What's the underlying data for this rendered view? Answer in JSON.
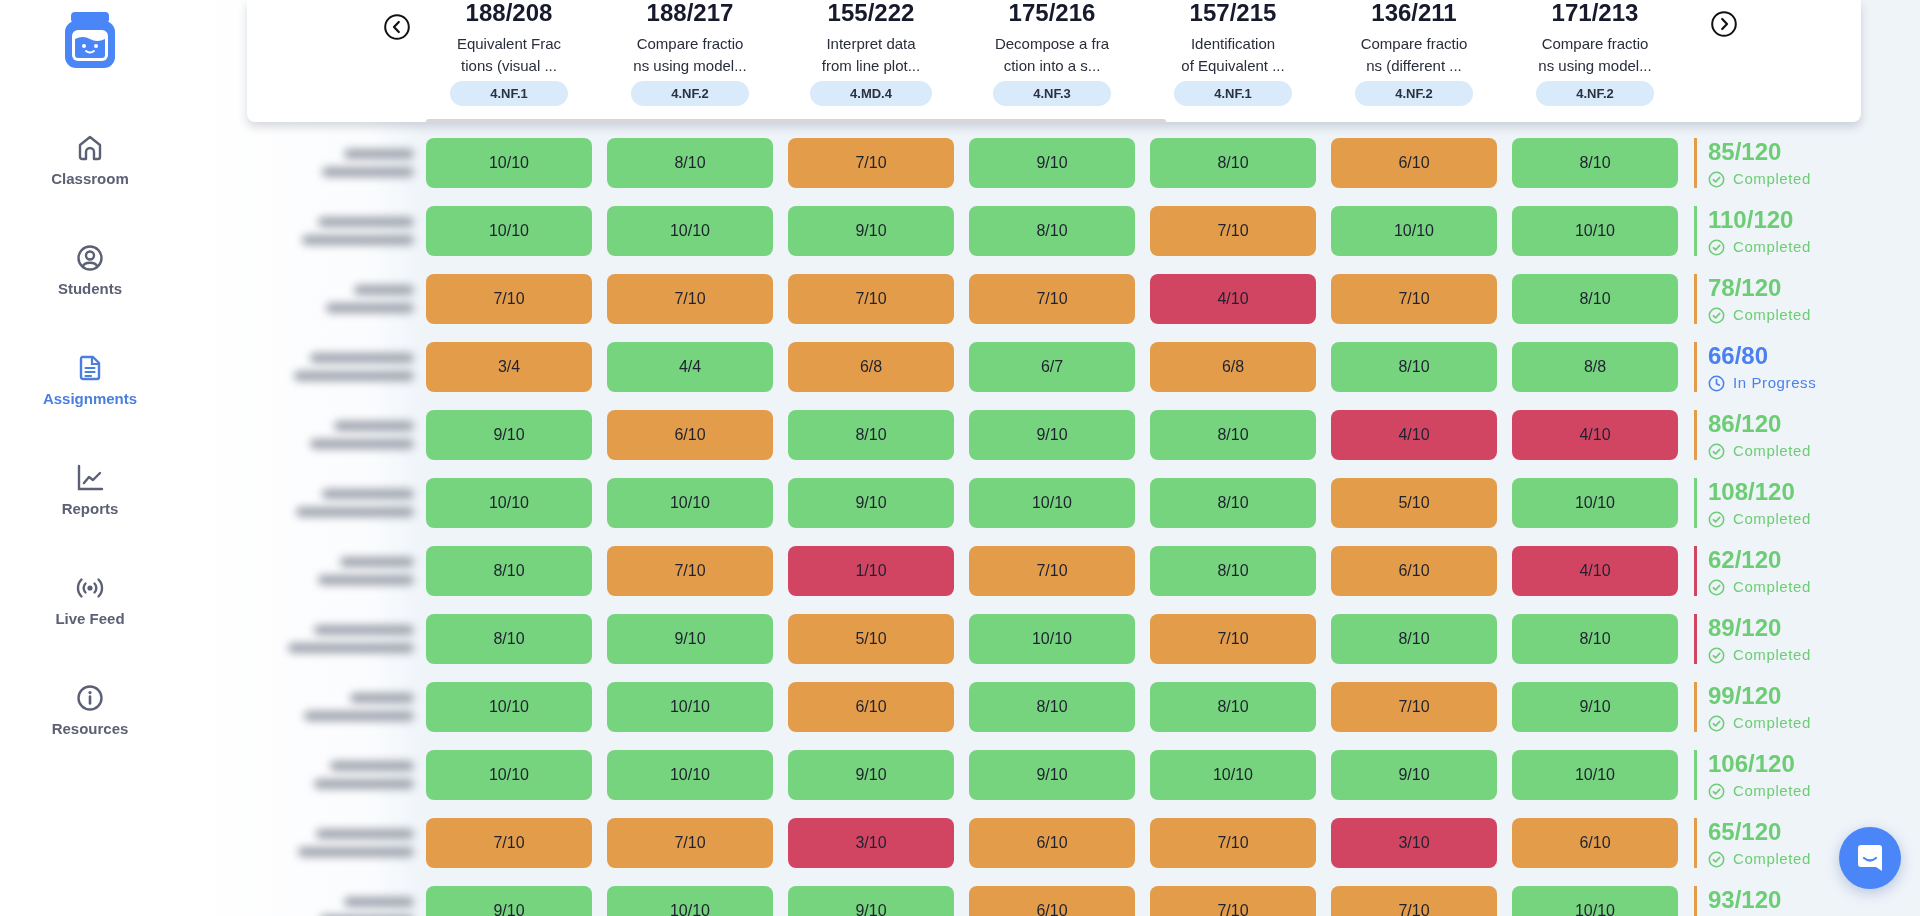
{
  "sidebar": {
    "nav": [
      {
        "label": "Classroom",
        "selected": false
      },
      {
        "label": "Students",
        "selected": false
      },
      {
        "label": "Assignments",
        "selected": true
      },
      {
        "label": "Reports",
        "selected": false
      },
      {
        "label": "Live Feed",
        "selected": false
      },
      {
        "label": "Resources",
        "selected": false
      }
    ]
  },
  "assignment_columns": [
    {
      "count": "188/208",
      "title": [
        "Equivalent Frac",
        "tions (visual ..."
      ],
      "tag": "4.NF.1"
    },
    {
      "count": "188/217",
      "title": [
        "Compare fractio",
        "ns using model..."
      ],
      "tag": "4.NF.2"
    },
    {
      "count": "155/222",
      "title": [
        "Interpret data",
        "from line plot..."
      ],
      "tag": "4.MD.4"
    },
    {
      "count": "175/216",
      "title": [
        "Decompose a fra",
        "ction into a s..."
      ],
      "tag": "4.NF.3"
    },
    {
      "count": "157/215",
      "title": [
        "Identification",
        "of Equivalent ..."
      ],
      "tag": "4.NF.1"
    },
    {
      "count": "136/211",
      "title": [
        "Compare fractio",
        "ns (different ..."
      ],
      "tag": "4.NF.2"
    },
    {
      "count": "171/213",
      "title": [
        "Compare fractio",
        "ns using model..."
      ],
      "tag": "4.NF.2"
    }
  ],
  "rows": [
    {
      "cells": [
        {
          "score": "10/10",
          "color": "#76d37e"
        },
        {
          "score": "8/10",
          "color": "#76d37e"
        },
        {
          "score": "7/10",
          "color": "#e39c4a"
        },
        {
          "score": "9/10",
          "color": "#76d37e"
        },
        {
          "score": "8/10",
          "color": "#76d37e"
        },
        {
          "score": "6/10",
          "color": "#e39c4a"
        },
        {
          "score": "8/10",
          "color": "#76d37e"
        }
      ],
      "next_cell": {
        "color": "#e39c4a"
      },
      "total": {
        "score": "85/120",
        "status": "Completed",
        "kind": "completed"
      }
    },
    {
      "cells": [
        {
          "score": "10/10",
          "color": "#76d37e"
        },
        {
          "score": "10/10",
          "color": "#76d37e"
        },
        {
          "score": "9/10",
          "color": "#76d37e"
        },
        {
          "score": "8/10",
          "color": "#76d37e"
        },
        {
          "score": "7/10",
          "color": "#e39c4a"
        },
        {
          "score": "10/10",
          "color": "#76d37e"
        },
        {
          "score": "10/10",
          "color": "#76d37e"
        }
      ],
      "next_cell": {
        "color": "#76d37e"
      },
      "total": {
        "score": "110/120",
        "status": "Completed",
        "kind": "completed"
      }
    },
    {
      "cells": [
        {
          "score": "7/10",
          "color": "#e39c4a"
        },
        {
          "score": "7/10",
          "color": "#e39c4a"
        },
        {
          "score": "7/10",
          "color": "#e39c4a"
        },
        {
          "score": "7/10",
          "color": "#e39c4a"
        },
        {
          "score": "4/10",
          "color": "#d24562"
        },
        {
          "score": "7/10",
          "color": "#e39c4a"
        },
        {
          "score": "8/10",
          "color": "#76d37e"
        }
      ],
      "next_cell": {
        "color": "#e39c4a"
      },
      "total": {
        "score": "78/120",
        "status": "Completed",
        "kind": "completed"
      }
    },
    {
      "cells": [
        {
          "score": "3/4",
          "color": "#e39c4a"
        },
        {
          "score": "4/4",
          "color": "#76d37e"
        },
        {
          "score": "6/8",
          "color": "#e39c4a"
        },
        {
          "score": "6/7",
          "color": "#76d37e"
        },
        {
          "score": "6/8",
          "color": "#e39c4a"
        },
        {
          "score": "8/10",
          "color": "#76d37e"
        },
        {
          "score": "8/8",
          "color": "#76d37e"
        }
      ],
      "next_cell": {
        "color": "#e39c4a"
      },
      "total": {
        "score": "66/80",
        "status": "In Progress",
        "kind": "in_progress"
      }
    },
    {
      "cells": [
        {
          "score": "9/10",
          "color": "#76d37e"
        },
        {
          "score": "6/10",
          "color": "#e39c4a"
        },
        {
          "score": "8/10",
          "color": "#76d37e"
        },
        {
          "score": "9/10",
          "color": "#76d37e"
        },
        {
          "score": "8/10",
          "color": "#76d37e"
        },
        {
          "score": "4/10",
          "color": "#d24562"
        },
        {
          "score": "4/10",
          "color": "#d24562"
        }
      ],
      "next_cell": {
        "color": "#e39c4a"
      },
      "total": {
        "score": "86/120",
        "status": "Completed",
        "kind": "completed"
      }
    },
    {
      "cells": [
        {
          "score": "10/10",
          "color": "#76d37e"
        },
        {
          "score": "10/10",
          "color": "#76d37e"
        },
        {
          "score": "9/10",
          "color": "#76d37e"
        },
        {
          "score": "10/10",
          "color": "#76d37e"
        },
        {
          "score": "8/10",
          "color": "#76d37e"
        },
        {
          "score": "5/10",
          "color": "#e39c4a"
        },
        {
          "score": "10/10",
          "color": "#76d37e"
        }
      ],
      "next_cell": {
        "color": "#76d37e"
      },
      "total": {
        "score": "108/120",
        "status": "Completed",
        "kind": "completed"
      }
    },
    {
      "cells": [
        {
          "score": "8/10",
          "color": "#76d37e"
        },
        {
          "score": "7/10",
          "color": "#e39c4a"
        },
        {
          "score": "1/10",
          "color": "#d24562"
        },
        {
          "score": "7/10",
          "color": "#e39c4a"
        },
        {
          "score": "8/10",
          "color": "#76d37e"
        },
        {
          "score": "6/10",
          "color": "#e39c4a"
        },
        {
          "score": "4/10",
          "color": "#d24562"
        }
      ],
      "next_cell": {
        "color": "#d24562"
      },
      "total": {
        "score": "62/120",
        "status": "Completed",
        "kind": "completed"
      }
    },
    {
      "cells": [
        {
          "score": "8/10",
          "color": "#76d37e"
        },
        {
          "score": "9/10",
          "color": "#76d37e"
        },
        {
          "score": "5/10",
          "color": "#e39c4a"
        },
        {
          "score": "10/10",
          "color": "#76d37e"
        },
        {
          "score": "7/10",
          "color": "#e39c4a"
        },
        {
          "score": "8/10",
          "color": "#76d37e"
        },
        {
          "score": "8/10",
          "color": "#76d37e"
        }
      ],
      "next_cell": {
        "color": "#d24562"
      },
      "total": {
        "score": "89/120",
        "status": "Completed",
        "kind": "completed"
      }
    },
    {
      "cells": [
        {
          "score": "10/10",
          "color": "#76d37e"
        },
        {
          "score": "10/10",
          "color": "#76d37e"
        },
        {
          "score": "6/10",
          "color": "#e39c4a"
        },
        {
          "score": "8/10",
          "color": "#76d37e"
        },
        {
          "score": "8/10",
          "color": "#76d37e"
        },
        {
          "score": "7/10",
          "color": "#e39c4a"
        },
        {
          "score": "9/10",
          "color": "#76d37e"
        }
      ],
      "next_cell": {
        "color": "#e39c4a"
      },
      "total": {
        "score": "99/120",
        "status": "Completed",
        "kind": "completed"
      }
    },
    {
      "cells": [
        {
          "score": "10/10",
          "color": "#76d37e"
        },
        {
          "score": "10/10",
          "color": "#76d37e"
        },
        {
          "score": "9/10",
          "color": "#76d37e"
        },
        {
          "score": "9/10",
          "color": "#76d37e"
        },
        {
          "score": "10/10",
          "color": "#76d37e"
        },
        {
          "score": "9/10",
          "color": "#76d37e"
        },
        {
          "score": "10/10",
          "color": "#76d37e"
        }
      ],
      "next_cell": {
        "color": "#76d37e"
      },
      "total": {
        "score": "106/120",
        "status": "Completed",
        "kind": "completed"
      }
    },
    {
      "cells": [
        {
          "score": "7/10",
          "color": "#e39c4a"
        },
        {
          "score": "7/10",
          "color": "#e39c4a"
        },
        {
          "score": "3/10",
          "color": "#d24562"
        },
        {
          "score": "6/10",
          "color": "#e39c4a"
        },
        {
          "score": "7/10",
          "color": "#e39c4a"
        },
        {
          "score": "3/10",
          "color": "#d24562"
        },
        {
          "score": "6/10",
          "color": "#e39c4a"
        }
      ],
      "next_cell": {
        "color": "#e39c4a"
      },
      "total": {
        "score": "65/120",
        "status": "Completed",
        "kind": "completed"
      }
    },
    {
      "cells": [
        {
          "score": "9/10",
          "color": "#76d37e"
        },
        {
          "score": "10/10",
          "color": "#76d37e"
        },
        {
          "score": "9/10",
          "color": "#76d37e"
        },
        {
          "score": "6/10",
          "color": "#e39c4a"
        },
        {
          "score": "7/10",
          "color": "#e39c4a"
        },
        {
          "score": "7/10",
          "color": "#e39c4a"
        },
        {
          "score": "10/10",
          "color": "#76d37e"
        }
      ],
      "next_cell": {
        "color": "#e39c4a"
      },
      "total": {
        "score": "93/120",
        "kind": "completed"
      }
    }
  ]
}
